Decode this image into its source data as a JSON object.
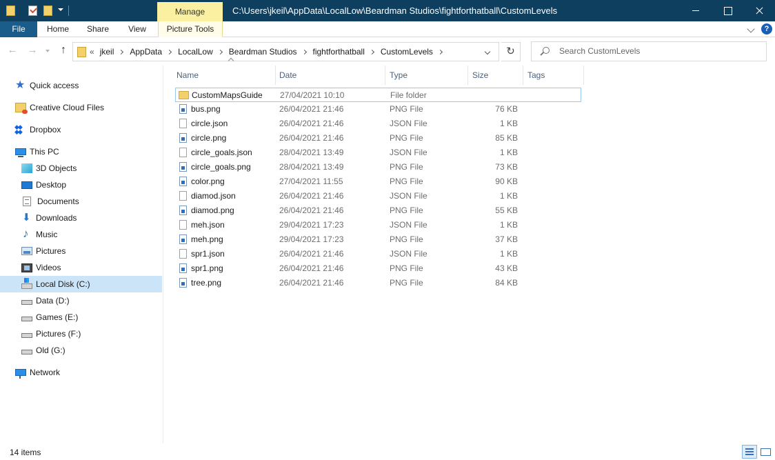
{
  "titlebar": {
    "manage_label": "Manage",
    "window_title": "C:\\Users\\jkeil\\AppData\\LocalLow\\Beardman Studios\\fightforthatball\\CustomLevels"
  },
  "ribbon": {
    "file": "File",
    "home": "Home",
    "share": "Share",
    "view": "View",
    "picture_tools": "Picture Tools",
    "help": "?"
  },
  "address": {
    "overflow": "«",
    "crumbs": [
      "jkeil",
      "AppData",
      "LocalLow",
      "Beardman Studios",
      "fightforthatball",
      "CustomLevels"
    ],
    "search_placeholder": "Search CustomLevels"
  },
  "nav": {
    "quick_access": "Quick access",
    "creative_cloud": "Creative Cloud Files",
    "dropbox": "Dropbox",
    "this_pc": "This PC",
    "objects3d": "3D Objects",
    "desktop": "Desktop",
    "documents": "Documents",
    "downloads": "Downloads",
    "music": "Music",
    "pictures": "Pictures",
    "videos": "Videos",
    "local_disk": "Local Disk (C:)",
    "data": "Data (D:)",
    "games": "Games (E:)",
    "pictures_drive": "Pictures (F:)",
    "old": "Old (G:)",
    "network": "Network"
  },
  "columns": {
    "name": "Name",
    "date": "Date",
    "type": "Type",
    "size": "Size",
    "tags": "Tags"
  },
  "files": [
    {
      "name": "CustomMapsGuide",
      "date": "27/04/2021 10:10",
      "type": "File folder",
      "size": "",
      "icon": "folder-icon"
    },
    {
      "name": "bus.png",
      "date": "26/04/2021 21:46",
      "type": "PNG File",
      "size": "76 KB",
      "icon": "png-file-icon"
    },
    {
      "name": "circle.json",
      "date": "26/04/2021 21:46",
      "type": "JSON File",
      "size": "1 KB",
      "icon": "json-file-icon"
    },
    {
      "name": "circle.png",
      "date": "26/04/2021 21:46",
      "type": "PNG File",
      "size": "85 KB",
      "icon": "png-file-icon"
    },
    {
      "name": "circle_goals.json",
      "date": "28/04/2021 13:49",
      "type": "JSON File",
      "size": "1 KB",
      "icon": "json-file-icon"
    },
    {
      "name": "circle_goals.png",
      "date": "28/04/2021 13:49",
      "type": "PNG File",
      "size": "73 KB",
      "icon": "png-file-icon"
    },
    {
      "name": "color.png",
      "date": "27/04/2021 11:55",
      "type": "PNG File",
      "size": "90 KB",
      "icon": "png-file-icon"
    },
    {
      "name": "diamod.json",
      "date": "26/04/2021 21:46",
      "type": "JSON File",
      "size": "1 KB",
      "icon": "json-file-icon"
    },
    {
      "name": "diamod.png",
      "date": "26/04/2021 21:46",
      "type": "PNG File",
      "size": "55 KB",
      "icon": "png-file-icon"
    },
    {
      "name": "meh.json",
      "date": "29/04/2021 17:23",
      "type": "JSON File",
      "size": "1 KB",
      "icon": "json-file-icon"
    },
    {
      "name": "meh.png",
      "date": "29/04/2021 17:23",
      "type": "PNG File",
      "size": "37 KB",
      "icon": "png-file-icon"
    },
    {
      "name": "spr1.json",
      "date": "26/04/2021 21:46",
      "type": "JSON File",
      "size": "1 KB",
      "icon": "json-file-icon"
    },
    {
      "name": "spr1.png",
      "date": "26/04/2021 21:46",
      "type": "PNG File",
      "size": "43 KB",
      "icon": "png-file-icon"
    },
    {
      "name": "tree.png",
      "date": "26/04/2021 21:46",
      "type": "PNG File",
      "size": "84 KB",
      "icon": "png-file-icon"
    }
  ],
  "status": {
    "item_count": "14 items"
  },
  "colors": {
    "titlebar": "#0f3f5e",
    "file_tab": "#1a5c8a",
    "manage_tab": "#fbf0a1",
    "selection": "#cce4f7"
  }
}
